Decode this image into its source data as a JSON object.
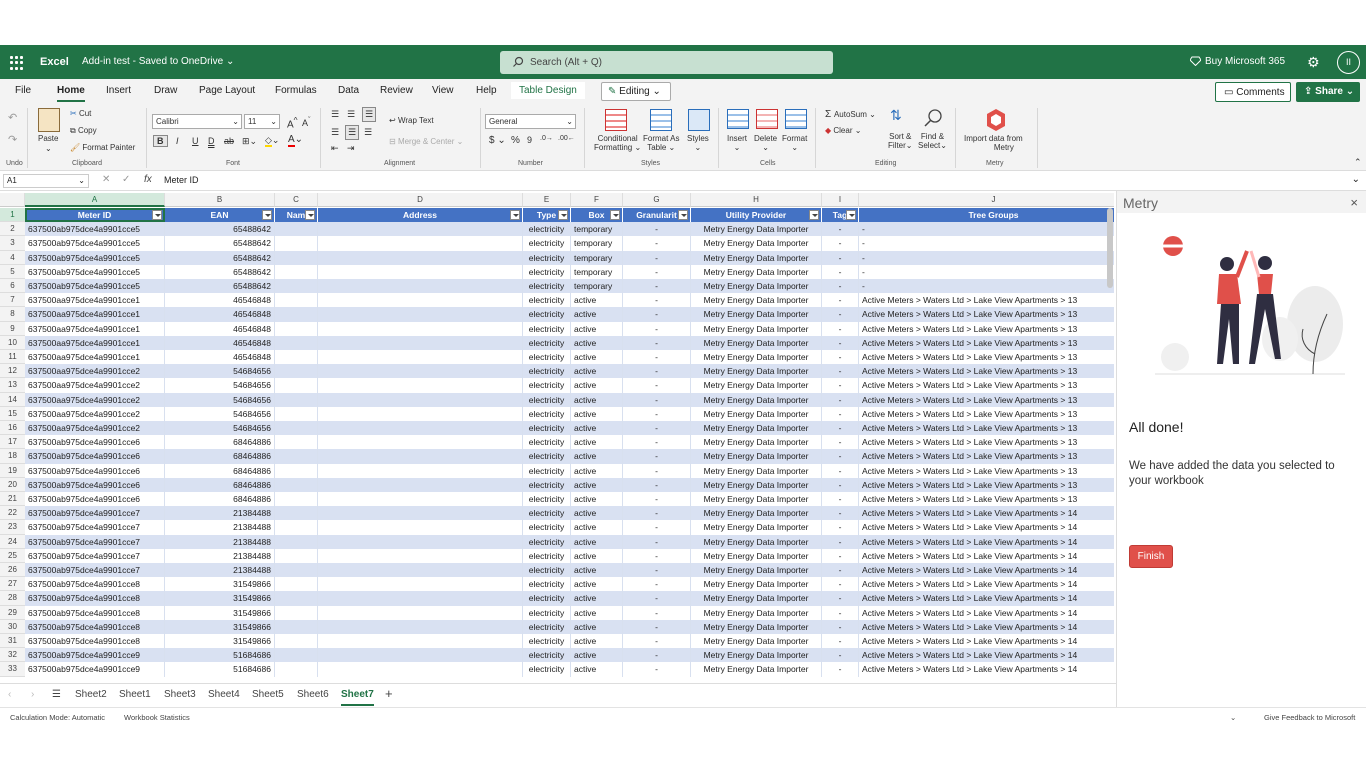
{
  "title_bar": {
    "app_name": "Excel",
    "doc_name": "Add-in test",
    "save_status": "Saved to OneDrive",
    "search_placeholder": "Search (Alt + Q)",
    "buy_label": "Buy Microsoft 365",
    "avatar_initials": "II"
  },
  "ribbon_tabs": {
    "file": "File",
    "home": "Home",
    "insert": "Insert",
    "draw": "Draw",
    "page_layout": "Page Layout",
    "formulas": "Formulas",
    "data": "Data",
    "review": "Review",
    "view": "View",
    "help": "Help",
    "table_design": "Table Design",
    "editing_mode": "Editing",
    "comments": "Comments",
    "share": "Share"
  },
  "ribbon": {
    "undo_group": "Undo",
    "paste": "Paste",
    "cut": "Cut",
    "copy": "Copy",
    "format_painter": "Format Painter",
    "clipboard_group": "Clipboard",
    "font_name": "Calibri",
    "font_size": "11",
    "font_group": "Font",
    "wrap_text": "Wrap Text",
    "merge_center": "Merge & Center",
    "alignment_group": "Alignment",
    "number_format": "General",
    "number_group": "Number",
    "conditional_formatting_1": "Conditional",
    "conditional_formatting_2": "Formatting",
    "format_as_table_1": "Format As",
    "format_as_table_2": "Table",
    "styles": "Styles",
    "styles_group": "Styles",
    "insert": "Insert",
    "delete": "Delete",
    "format": "Format",
    "cells_group": "Cells",
    "autosum": "AutoSum",
    "clear": "Clear",
    "sort_filter_1": "Sort &",
    "sort_filter_2": "Filter",
    "find_select_1": "Find &",
    "find_select_2": "Select",
    "editing_group": "Editing",
    "import_1": "Import data from",
    "import_2": "Metry",
    "metry_group": "Metry"
  },
  "formula_bar": {
    "name_box": "A1",
    "fx": "fx",
    "content": "Meter ID"
  },
  "columns": [
    "A",
    "B",
    "C",
    "D",
    "E",
    "F",
    "G",
    "H",
    "I",
    "J"
  ],
  "table_headers": [
    "Meter ID",
    "EAN",
    "Nam",
    "Address",
    "Type",
    "Box",
    "Granularit",
    "Utility Provider",
    "Tag",
    "Tree Groups"
  ],
  "rows": [
    [
      "637500ab975dce4a9901cce5",
      "65488642",
      "",
      "",
      "electricity",
      "temporary",
      "-",
      "Metry Energy Data Importer",
      "-",
      "-"
    ],
    [
      "637500ab975dce4a9901cce5",
      "65488642",
      "",
      "",
      "electricity",
      "temporary",
      "-",
      "Metry Energy Data Importer",
      "-",
      "-"
    ],
    [
      "637500ab975dce4a9901cce5",
      "65488642",
      "",
      "",
      "electricity",
      "temporary",
      "-",
      "Metry Energy Data Importer",
      "-",
      "-"
    ],
    [
      "637500ab975dce4a9901cce5",
      "65488642",
      "",
      "",
      "electricity",
      "temporary",
      "-",
      "Metry Energy Data Importer",
      "-",
      "-"
    ],
    [
      "637500ab975dce4a9901cce5",
      "65488642",
      "",
      "",
      "electricity",
      "temporary",
      "-",
      "Metry Energy Data Importer",
      "-",
      "-"
    ],
    [
      "637500aa975dce4a9901cce1",
      "46546848",
      "",
      "",
      "electricity",
      "active",
      "-",
      "Metry Energy Data Importer",
      "-",
      "Active Meters > Waters Ltd > Lake View Apartments > 13"
    ],
    [
      "637500aa975dce4a9901cce1",
      "46546848",
      "",
      "",
      "electricity",
      "active",
      "-",
      "Metry Energy Data Importer",
      "-",
      "Active Meters > Waters Ltd > Lake View Apartments > 13"
    ],
    [
      "637500aa975dce4a9901cce1",
      "46546848",
      "",
      "",
      "electricity",
      "active",
      "-",
      "Metry Energy Data Importer",
      "-",
      "Active Meters > Waters Ltd > Lake View Apartments > 13"
    ],
    [
      "637500aa975dce4a9901cce1",
      "46546848",
      "",
      "",
      "electricity",
      "active",
      "-",
      "Metry Energy Data Importer",
      "-",
      "Active Meters > Waters Ltd > Lake View Apartments > 13"
    ],
    [
      "637500aa975dce4a9901cce1",
      "46546848",
      "",
      "",
      "electricity",
      "active",
      "-",
      "Metry Energy Data Importer",
      "-",
      "Active Meters > Waters Ltd > Lake View Apartments > 13"
    ],
    [
      "637500aa975dce4a9901cce2",
      "54684656",
      "",
      "",
      "electricity",
      "active",
      "-",
      "Metry Energy Data Importer",
      "-",
      "Active Meters > Waters Ltd > Lake View Apartments > 13"
    ],
    [
      "637500aa975dce4a9901cce2",
      "54684656",
      "",
      "",
      "electricity",
      "active",
      "-",
      "Metry Energy Data Importer",
      "-",
      "Active Meters > Waters Ltd > Lake View Apartments > 13"
    ],
    [
      "637500aa975dce4a9901cce2",
      "54684656",
      "",
      "",
      "electricity",
      "active",
      "-",
      "Metry Energy Data Importer",
      "-",
      "Active Meters > Waters Ltd > Lake View Apartments > 13"
    ],
    [
      "637500aa975dce4a9901cce2",
      "54684656",
      "",
      "",
      "electricity",
      "active",
      "-",
      "Metry Energy Data Importer",
      "-",
      "Active Meters > Waters Ltd > Lake View Apartments > 13"
    ],
    [
      "637500aa975dce4a9901cce2",
      "54684656",
      "",
      "",
      "electricity",
      "active",
      "-",
      "Metry Energy Data Importer",
      "-",
      "Active Meters > Waters Ltd > Lake View Apartments > 13"
    ],
    [
      "637500ab975dce4a9901cce6",
      "68464886",
      "",
      "",
      "electricity",
      "active",
      "-",
      "Metry Energy Data Importer",
      "-",
      "Active Meters > Waters Ltd > Lake View Apartments > 13"
    ],
    [
      "637500ab975dce4a9901cce6",
      "68464886",
      "",
      "",
      "electricity",
      "active",
      "-",
      "Metry Energy Data Importer",
      "-",
      "Active Meters > Waters Ltd > Lake View Apartments > 13"
    ],
    [
      "637500ab975dce4a9901cce6",
      "68464886",
      "",
      "",
      "electricity",
      "active",
      "-",
      "Metry Energy Data Importer",
      "-",
      "Active Meters > Waters Ltd > Lake View Apartments > 13"
    ],
    [
      "637500ab975dce4a9901cce6",
      "68464886",
      "",
      "",
      "electricity",
      "active",
      "-",
      "Metry Energy Data Importer",
      "-",
      "Active Meters > Waters Ltd > Lake View Apartments > 13"
    ],
    [
      "637500ab975dce4a9901cce6",
      "68464886",
      "",
      "",
      "electricity",
      "active",
      "-",
      "Metry Energy Data Importer",
      "-",
      "Active Meters > Waters Ltd > Lake View Apartments > 13"
    ],
    [
      "637500ab975dce4a9901cce7",
      "21384488",
      "",
      "",
      "electricity",
      "active",
      "-",
      "Metry Energy Data Importer",
      "-",
      "Active Meters > Waters Ltd > Lake View Apartments > 14"
    ],
    [
      "637500ab975dce4a9901cce7",
      "21384488",
      "",
      "",
      "electricity",
      "active",
      "-",
      "Metry Energy Data Importer",
      "-",
      "Active Meters > Waters Ltd > Lake View Apartments > 14"
    ],
    [
      "637500ab975dce4a9901cce7",
      "21384488",
      "",
      "",
      "electricity",
      "active",
      "-",
      "Metry Energy Data Importer",
      "-",
      "Active Meters > Waters Ltd > Lake View Apartments > 14"
    ],
    [
      "637500ab975dce4a9901cce7",
      "21384488",
      "",
      "",
      "electricity",
      "active",
      "-",
      "Metry Energy Data Importer",
      "-",
      "Active Meters > Waters Ltd > Lake View Apartments > 14"
    ],
    [
      "637500ab975dce4a9901cce7",
      "21384488",
      "",
      "",
      "electricity",
      "active",
      "-",
      "Metry Energy Data Importer",
      "-",
      "Active Meters > Waters Ltd > Lake View Apartments > 14"
    ],
    [
      "637500ab975dce4a9901cce8",
      "31549866",
      "",
      "",
      "electricity",
      "active",
      "-",
      "Metry Energy Data Importer",
      "-",
      "Active Meters > Waters Ltd > Lake View Apartments > 14"
    ],
    [
      "637500ab975dce4a9901cce8",
      "31549866",
      "",
      "",
      "electricity",
      "active",
      "-",
      "Metry Energy Data Importer",
      "-",
      "Active Meters > Waters Ltd > Lake View Apartments > 14"
    ],
    [
      "637500ab975dce4a9901cce8",
      "31549866",
      "",
      "",
      "electricity",
      "active",
      "-",
      "Metry Energy Data Importer",
      "-",
      "Active Meters > Waters Ltd > Lake View Apartments > 14"
    ],
    [
      "637500ab975dce4a9901cce8",
      "31549866",
      "",
      "",
      "electricity",
      "active",
      "-",
      "Metry Energy Data Importer",
      "-",
      "Active Meters > Waters Ltd > Lake View Apartments > 14"
    ],
    [
      "637500ab975dce4a9901cce8",
      "31549866",
      "",
      "",
      "electricity",
      "active",
      "-",
      "Metry Energy Data Importer",
      "-",
      "Active Meters > Waters Ltd > Lake View Apartments > 14"
    ],
    [
      "637500ab975dce4a9901cce9",
      "51684686",
      "",
      "",
      "electricity",
      "active",
      "-",
      "Metry Energy Data Importer",
      "-",
      "Active Meters > Waters Ltd > Lake View Apartments > 14"
    ],
    [
      "637500ab975dce4a9901cce9",
      "51684686",
      "",
      "",
      "electricity",
      "active",
      "-",
      "Metry Energy Data Importer",
      "-",
      "Active Meters > Waters Ltd > Lake View Apartments > 14"
    ]
  ],
  "task_pane": {
    "title": "Metry",
    "close": "×",
    "heading": "All done!",
    "message": "We have added the data you selected to your workbook",
    "finish_button": "Finish"
  },
  "sheet_tabs": [
    "Sheet2",
    "Sheet1",
    "Sheet3",
    "Sheet4",
    "Sheet5",
    "Sheet6",
    "Sheet7"
  ],
  "active_sheet": "Sheet7",
  "status_bar": {
    "calc_mode": "Calculation Mode: Automatic",
    "workbook_stats": "Workbook Statistics",
    "feedback": "Give Feedback to Microsoft"
  },
  "colors": {
    "excel_green": "#217346",
    "table_header": "#4472c4",
    "band_row": "#d9e1f2",
    "finish_red": "#e0504a"
  }
}
